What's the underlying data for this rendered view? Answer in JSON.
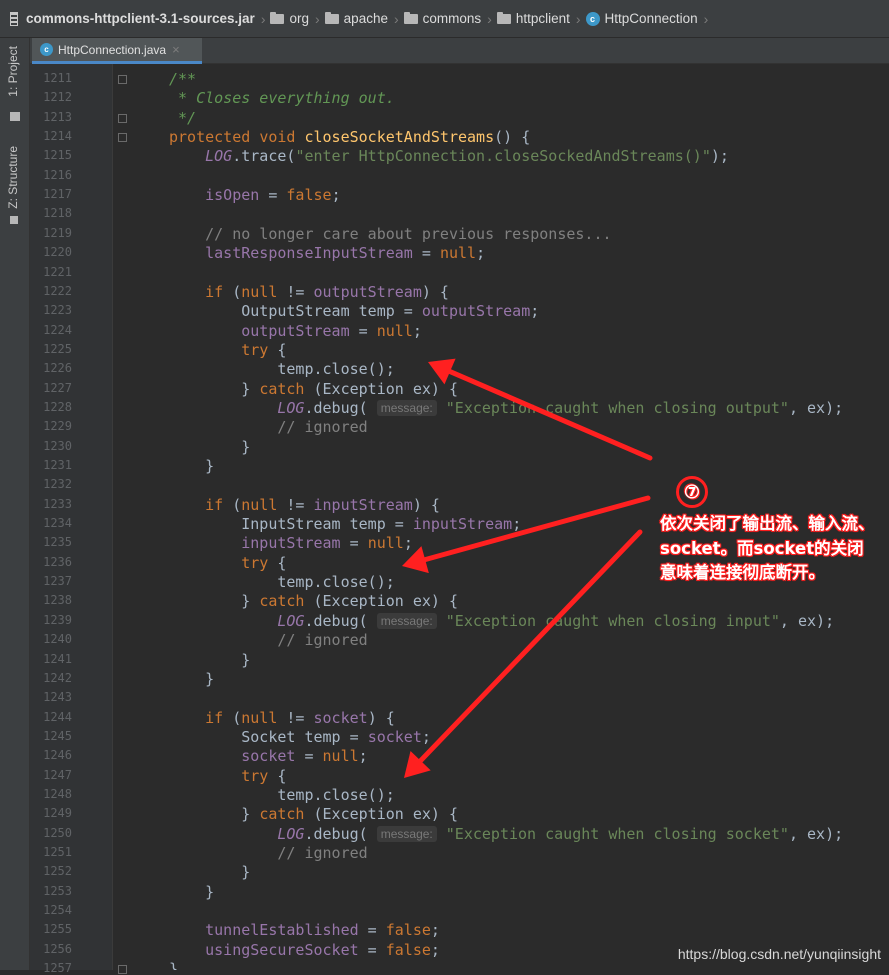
{
  "breadcrumb": {
    "jar": "commons-httpclient-3.1-sources.jar",
    "packages": [
      "org",
      "apache",
      "commons",
      "httpclient"
    ],
    "class": "HttpConnection"
  },
  "toolwindows": {
    "project": "1: Project",
    "structure": "Z: Structure"
  },
  "editor_tab": {
    "filename": "HttpConnection.java",
    "close": "×"
  },
  "line_numbers": [
    "1211",
    "1212",
    "1213",
    "1214",
    "1215",
    "1216",
    "1217",
    "1218",
    "1219",
    "1220",
    "1221",
    "1222",
    "1223",
    "1224",
    "1225",
    "1226",
    "1227",
    "1228",
    "1229",
    "1230",
    "1231",
    "1232",
    "1233",
    "1234",
    "1235",
    "1236",
    "1237",
    "1238",
    "1239",
    "1240",
    "1241",
    "1242",
    "1243",
    "1244",
    "1245",
    "1246",
    "1247",
    "1248",
    "1249",
    "1250",
    "1251",
    "1252",
    "1253",
    "1254",
    "1255",
    "1256",
    "1257"
  ],
  "code_lines": [
    [
      [
        "doc",
        "/**"
      ]
    ],
    [
      [
        "doc",
        " * Closes everything out."
      ]
    ],
    [
      [
        "doc",
        " */"
      ]
    ],
    [
      [
        "kw",
        "protected "
      ],
      [
        "kw",
        "void "
      ],
      [
        "mth",
        "closeSocketAndStreams"
      ],
      [
        "p",
        "() {"
      ]
    ],
    [
      [
        "p",
        "    "
      ],
      [
        "sfld",
        "LOG"
      ],
      [
        "p",
        ".trace("
      ],
      [
        "str",
        "\"enter HttpConnection.closeSockedAndStreams()\""
      ],
      [
        "p",
        ");"
      ]
    ],
    [],
    [
      [
        "p",
        "    "
      ],
      [
        "fld",
        "isOpen"
      ],
      [
        "p",
        " = "
      ],
      [
        "kw",
        "false"
      ],
      [
        "p",
        ";"
      ]
    ],
    [],
    [
      [
        "p",
        "    "
      ],
      [
        "cmt",
        "// no longer care about previous responses..."
      ]
    ],
    [
      [
        "p",
        "    "
      ],
      [
        "fld",
        "lastResponseInputStream"
      ],
      [
        "p",
        " = "
      ],
      [
        "kw",
        "null"
      ],
      [
        "p",
        ";"
      ]
    ],
    [],
    [
      [
        "p",
        "    "
      ],
      [
        "kw",
        "if "
      ],
      [
        "p",
        "("
      ],
      [
        "kw",
        "null"
      ],
      [
        "p",
        " != "
      ],
      [
        "fld",
        "outputStream"
      ],
      [
        "p",
        ") {"
      ]
    ],
    [
      [
        "p",
        "        OutputStream temp = "
      ],
      [
        "fld",
        "outputStream"
      ],
      [
        "p",
        ";"
      ]
    ],
    [
      [
        "p",
        "        "
      ],
      [
        "fld",
        "outputStream"
      ],
      [
        "p",
        " = "
      ],
      [
        "kw",
        "null"
      ],
      [
        "p",
        ";"
      ]
    ],
    [
      [
        "p",
        "        "
      ],
      [
        "kw",
        "try "
      ],
      [
        "p",
        "{"
      ]
    ],
    [
      [
        "p",
        "            temp.close();"
      ]
    ],
    [
      [
        "p",
        "        } "
      ],
      [
        "kw",
        "catch "
      ],
      [
        "p",
        "(Exception ex) {"
      ]
    ],
    [
      [
        "p",
        "            "
      ],
      [
        "sfld",
        "LOG"
      ],
      [
        "p",
        ".debug( "
      ],
      [
        "hint",
        "message:"
      ],
      [
        "p",
        " "
      ],
      [
        "str",
        "\"Exception caught when closing output\""
      ],
      [
        "p",
        ", ex);"
      ]
    ],
    [
      [
        "p",
        "            "
      ],
      [
        "cmt",
        "// ignored"
      ]
    ],
    [
      [
        "p",
        "        }"
      ]
    ],
    [
      [
        "p",
        "    }"
      ]
    ],
    [],
    [
      [
        "p",
        "    "
      ],
      [
        "kw",
        "if "
      ],
      [
        "p",
        "("
      ],
      [
        "kw",
        "null"
      ],
      [
        "p",
        " != "
      ],
      [
        "fld",
        "inputStream"
      ],
      [
        "p",
        ") {"
      ]
    ],
    [
      [
        "p",
        "        InputStream temp = "
      ],
      [
        "fld",
        "inputStream"
      ],
      [
        "p",
        ";"
      ]
    ],
    [
      [
        "p",
        "        "
      ],
      [
        "fld",
        "inputStream"
      ],
      [
        "p",
        " = "
      ],
      [
        "kw",
        "null"
      ],
      [
        "p",
        ";"
      ]
    ],
    [
      [
        "p",
        "        "
      ],
      [
        "kw",
        "try "
      ],
      [
        "p",
        "{"
      ]
    ],
    [
      [
        "p",
        "            temp.close();"
      ]
    ],
    [
      [
        "p",
        "        } "
      ],
      [
        "kw",
        "catch "
      ],
      [
        "p",
        "(Exception ex) {"
      ]
    ],
    [
      [
        "p",
        "            "
      ],
      [
        "sfld",
        "LOG"
      ],
      [
        "p",
        ".debug( "
      ],
      [
        "hint",
        "message:"
      ],
      [
        "p",
        " "
      ],
      [
        "str",
        "\"Exception caught when closing input\""
      ],
      [
        "p",
        ", ex);"
      ]
    ],
    [
      [
        "p",
        "            "
      ],
      [
        "cmt",
        "// ignored"
      ]
    ],
    [
      [
        "p",
        "        }"
      ]
    ],
    [
      [
        "p",
        "    }"
      ]
    ],
    [],
    [
      [
        "p",
        "    "
      ],
      [
        "kw",
        "if "
      ],
      [
        "p",
        "("
      ],
      [
        "kw",
        "null"
      ],
      [
        "p",
        " != "
      ],
      [
        "fld",
        "socket"
      ],
      [
        "p",
        ") {"
      ]
    ],
    [
      [
        "p",
        "        Socket temp = "
      ],
      [
        "fld",
        "socket"
      ],
      [
        "p",
        ";"
      ]
    ],
    [
      [
        "p",
        "        "
      ],
      [
        "fld",
        "socket"
      ],
      [
        "p",
        " = "
      ],
      [
        "kw",
        "null"
      ],
      [
        "p",
        ";"
      ]
    ],
    [
      [
        "p",
        "        "
      ],
      [
        "kw",
        "try "
      ],
      [
        "p",
        "{"
      ]
    ],
    [
      [
        "p",
        "            temp.close();"
      ]
    ],
    [
      [
        "p",
        "        } "
      ],
      [
        "kw",
        "catch "
      ],
      [
        "p",
        "(Exception ex) {"
      ]
    ],
    [
      [
        "p",
        "            "
      ],
      [
        "sfld",
        "LOG"
      ],
      [
        "p",
        ".debug( "
      ],
      [
        "hint",
        "message:"
      ],
      [
        "p",
        " "
      ],
      [
        "str",
        "\"Exception caught when closing socket\""
      ],
      [
        "p",
        ", ex);"
      ]
    ],
    [
      [
        "p",
        "            "
      ],
      [
        "cmt",
        "// ignored"
      ]
    ],
    [
      [
        "p",
        "        }"
      ]
    ],
    [
      [
        "p",
        "    }"
      ]
    ],
    [],
    [
      [
        "p",
        "    "
      ],
      [
        "fld",
        "tunnelEstablished"
      ],
      [
        "p",
        " = "
      ],
      [
        "kw",
        "false"
      ],
      [
        "p",
        ";"
      ]
    ],
    [
      [
        "p",
        "    "
      ],
      [
        "fld",
        "usingSecureSocket"
      ],
      [
        "p",
        " = "
      ],
      [
        "kw",
        "false"
      ],
      [
        "p",
        ";"
      ]
    ],
    [
      [
        "p",
        "}"
      ]
    ]
  ],
  "annotation": {
    "number": "⑦",
    "text": "依次关闭了输出流、输入流、socket。而socket的关闭意味着连接彻底断开。",
    "color": "#ff2020"
  },
  "watermark": "https://blog.csdn.net/yunqiinsight",
  "colors": {
    "background": "#2b2b2b",
    "keyword": "#cc7832",
    "field": "#9876aa",
    "string": "#6a8759",
    "comment": "#808080",
    "doc": "#629755",
    "method": "#ffc66d",
    "plain": "#a9b7c6"
  }
}
